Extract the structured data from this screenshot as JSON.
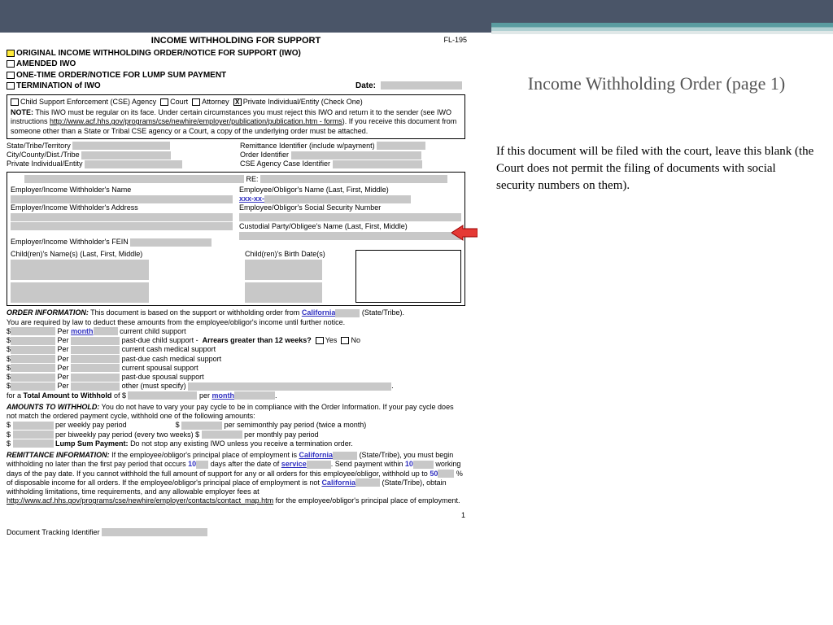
{
  "form_code": "FL-195",
  "title": "INCOME WITHHOLDING FOR SUPPORT",
  "options": [
    "ORIGINAL INCOME WITHHOLDING ORDER/NOTICE FOR SUPPORT (IWO)",
    "AMENDED IWO",
    "ONE-TIME ORDER/NOTICE FOR LUMP SUM PAYMENT",
    "TERMINATION of IWO"
  ],
  "date_label": "Date:",
  "entity_row": {
    "cse": "Child Support Enforcement (CSE) Agency",
    "court": "Court",
    "attorney": "Attorney",
    "private": "Private Individual/Entity  (Check One)"
  },
  "note_label": "NOTE:",
  "note_text1": "This IWO must be regular on its face. Under certain circumstances you must reject this IWO and return it to the sender (see IWO instructions ",
  "note_link": "http://www.acf.hhs.gov/programs/cse/newhire/employer/publication/publication.htm - forms",
  "note_text2": "). If you receive this document from someone other than a State or Tribal CSE agency or a Court, a copy of the underlying order must be attached.",
  "ids": {
    "state": "State/Tribe/Territory",
    "city": "City/County/Dist./Tribe",
    "priv": "Private Individual/Entity",
    "remit": "Remittance Identifier (include w/payment)",
    "order": "Order Identifier",
    "cse": "CSE Agency Case Identifier"
  },
  "re_label": "RE:",
  "parties": {
    "emp_name": "Employer/Income Withholder's Name",
    "obl_name": "Employee/Obligor's Name (Last, First, Middle)",
    "emp_addr": "Employer/Income Withholder's Address",
    "obl_ssn": "Employee/Obligor's Social Security Number",
    "cust": "Custodial Party/Obligee's Name (Last, First, Middle)",
    "fein": "Employer/Income Withholder's FEIN",
    "child_names": "Child(ren)'s Name(s) (Last, First, Middle)",
    "child_dates": "Child(ren)'s Birth Date(s)"
  },
  "ssn_placeholder": "xxx-xx-",
  "order_info": {
    "heading": "ORDER INFORMATION:",
    "text1": "This document is based on the support or withholding order from",
    "state": "California",
    "tail1": "(State/Tribe).",
    "text2": "You are required by law to deduct these amounts from the employee/obligor's income until further notice.",
    "per": "Per",
    "month": "month",
    "lines": [
      "current child support",
      "past-due child support -",
      "current cash medical support",
      "past-due cash medical support",
      "current spousal support",
      "past-due spousal support",
      "other (must specify)"
    ],
    "arrears_q": "Arrears greater than 12 weeks?",
    "yes": "Yes",
    "no": "No",
    "total": "Total Amount to Withhold",
    "fora": "for a",
    "of": "of $",
    "per2": "per"
  },
  "amounts": {
    "heading": "AMOUNTS TO WITHHOLD:",
    "text": "You do not have to vary your pay cycle to be in compliance with the Order Information. If your pay cycle does not match the ordered payment cycle, withhold one of the following amounts:",
    "weekly": "per weekly pay period",
    "biweekly": "per biweekly pay period (every two weeks) $",
    "semi": "per semimonthly pay period (twice a month)",
    "monthly": "per monthly pay period",
    "lump": "Lump Sum Payment:",
    "lump_text": "Do not stop any existing IWO unless you receive a termination order."
  },
  "remit": {
    "heading": "REMITTANCE INFORMATION:",
    "t1": "If the employee/obligor's principal place of employment is",
    "state": "California",
    "tail": "(State/Tribe),",
    "t2": "you must begin withholding no later than the first pay period that occurs",
    "days_val": "10",
    "t3": "days after the date of",
    "service": "service",
    "t4": ". Send payment within",
    "wd_val": "10",
    "t5": "working days of the pay date. If you cannot withhold the full amount of support for any or all orders for this employee/obligor, withhold up to",
    "pct": "50",
    "t6": "% of disposable income for all orders. If the employee/obligor's principal place of employment is not",
    "t7": "(State/Tribe), obtain withholding limitations, time requirements, and any allowable employer fees at",
    "link2": "http://www.acf.hhs.gov/programs/cse/newhire/employer/contacts/contact_map.htm",
    "t8": "for the employee/obligor's principal place of employment."
  },
  "page_num": "1",
  "tracking": "Document Tracking Identifier",
  "side": {
    "title": "Income Withholding Order (page 1)",
    "text": "If this document will be filed with the court, leave this blank (the Court does not permit the filing of documents with social security numbers on them)."
  }
}
